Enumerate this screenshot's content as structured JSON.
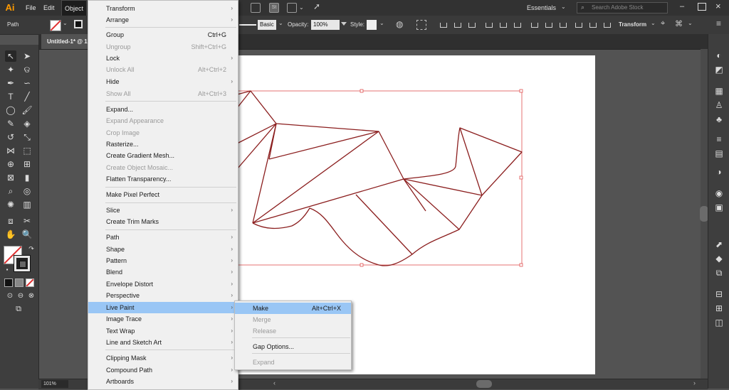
{
  "app": {
    "logo": "Ai"
  },
  "menubar": {
    "file": "File",
    "edit": "Edit",
    "object": "Object",
    "workspace": "Essentials",
    "search_placeholder": "Search Adobe Stock",
    "stock_badge": "St"
  },
  "control_bar": {
    "selection": "Path",
    "brush": "Basic",
    "opacity_label": "Opacity:",
    "opacity_value": "100%",
    "style_label": "Style:",
    "transform": "Transform"
  },
  "document": {
    "tab_title": "Untitled-1* @ 1",
    "zoom": "101%"
  },
  "object_menu": {
    "items": [
      {
        "label": "Transform",
        "shortcut": "",
        "submenu": true,
        "disabled": false
      },
      {
        "label": "Arrange",
        "shortcut": "",
        "submenu": true,
        "disabled": false
      },
      {
        "label": "Group",
        "shortcut": "Ctrl+G",
        "submenu": false,
        "disabled": false
      },
      {
        "label": "Ungroup",
        "shortcut": "Shift+Ctrl+G",
        "submenu": false,
        "disabled": true
      },
      {
        "label": "Lock",
        "shortcut": "",
        "submenu": true,
        "disabled": false
      },
      {
        "label": "Unlock All",
        "shortcut": "Alt+Ctrl+2",
        "submenu": false,
        "disabled": true
      },
      {
        "label": "Hide",
        "shortcut": "",
        "submenu": true,
        "disabled": false
      },
      {
        "label": "Show All",
        "shortcut": "Alt+Ctrl+3",
        "submenu": false,
        "disabled": true
      },
      {
        "label": "Expand...",
        "shortcut": "",
        "submenu": false,
        "disabled": false
      },
      {
        "label": "Expand Appearance",
        "shortcut": "",
        "submenu": false,
        "disabled": true
      },
      {
        "label": "Crop Image",
        "shortcut": "",
        "submenu": false,
        "disabled": true
      },
      {
        "label": "Rasterize...",
        "shortcut": "",
        "submenu": false,
        "disabled": false
      },
      {
        "label": "Create Gradient Mesh...",
        "shortcut": "",
        "submenu": false,
        "disabled": false
      },
      {
        "label": "Create Object Mosaic...",
        "shortcut": "",
        "submenu": false,
        "disabled": true
      },
      {
        "label": "Flatten Transparency...",
        "shortcut": "",
        "submenu": false,
        "disabled": false
      },
      {
        "label": "Make Pixel Perfect",
        "shortcut": "",
        "submenu": false,
        "disabled": false
      },
      {
        "label": "Slice",
        "shortcut": "",
        "submenu": true,
        "disabled": false
      },
      {
        "label": "Create Trim Marks",
        "shortcut": "",
        "submenu": false,
        "disabled": false
      },
      {
        "label": "Path",
        "shortcut": "",
        "submenu": true,
        "disabled": false
      },
      {
        "label": "Shape",
        "shortcut": "",
        "submenu": true,
        "disabled": false
      },
      {
        "label": "Pattern",
        "shortcut": "",
        "submenu": true,
        "disabled": false
      },
      {
        "label": "Blend",
        "shortcut": "",
        "submenu": true,
        "disabled": false
      },
      {
        "label": "Envelope Distort",
        "shortcut": "",
        "submenu": true,
        "disabled": false
      },
      {
        "label": "Perspective",
        "shortcut": "",
        "submenu": true,
        "disabled": false
      },
      {
        "label": "Live Paint",
        "shortcut": "",
        "submenu": true,
        "disabled": false,
        "highlighted": true
      },
      {
        "label": "Image Trace",
        "shortcut": "",
        "submenu": true,
        "disabled": false
      },
      {
        "label": "Text Wrap",
        "shortcut": "",
        "submenu": true,
        "disabled": false
      },
      {
        "label": "Line and Sketch Art",
        "shortcut": "",
        "submenu": true,
        "disabled": false
      },
      {
        "label": "Clipping Mask",
        "shortcut": "",
        "submenu": true,
        "disabled": false
      },
      {
        "label": "Compound Path",
        "shortcut": "",
        "submenu": true,
        "disabled": false
      },
      {
        "label": "Artboards",
        "shortcut": "",
        "submenu": true,
        "disabled": false
      }
    ]
  },
  "live_paint_submenu": {
    "items": [
      {
        "label": "Make",
        "shortcut": "Alt+Ctrl+X",
        "disabled": false,
        "highlighted": true
      },
      {
        "label": "Merge",
        "shortcut": "",
        "disabled": true
      },
      {
        "label": "Release",
        "shortcut": "",
        "disabled": true
      },
      {
        "label": "Gap Options...",
        "shortcut": "",
        "disabled": false
      },
      {
        "label": "Expand",
        "shortcut": "",
        "disabled": true
      }
    ]
  },
  "colors": {
    "ui_dark": "#323232",
    "menu_bg": "#f0f0f0",
    "menu_highlight": "#99c6f5",
    "path_stroke": "#8b1e1e",
    "bbox": "#e05050",
    "logo": "#ff9a00"
  },
  "icons": {
    "tools": [
      "selection-tool-icon",
      "direct-selection-tool-icon",
      "magic-wand-tool-icon",
      "lasso-tool-icon",
      "pen-tool-icon",
      "curvature-tool-icon",
      "type-tool-icon",
      "line-segment-tool-icon",
      "ellipse-tool-icon",
      "paintbrush-tool-icon",
      "shaper-tool-icon",
      "eraser-tool-icon",
      "rotate-tool-icon",
      "scale-tool-icon",
      "width-tool-icon",
      "free-transform-tool-icon",
      "shape-builder-tool-icon",
      "perspective-grid-tool-icon",
      "mesh-tool-icon",
      "gradient-tool-icon",
      "eyedropper-tool-icon",
      "blend-tool-icon",
      "symbol-sprayer-tool-icon",
      "column-graph-tool-icon",
      "artboard-tool-icon",
      "slice-tool-icon",
      "hand-tool-icon",
      "zoom-tool-icon"
    ]
  }
}
